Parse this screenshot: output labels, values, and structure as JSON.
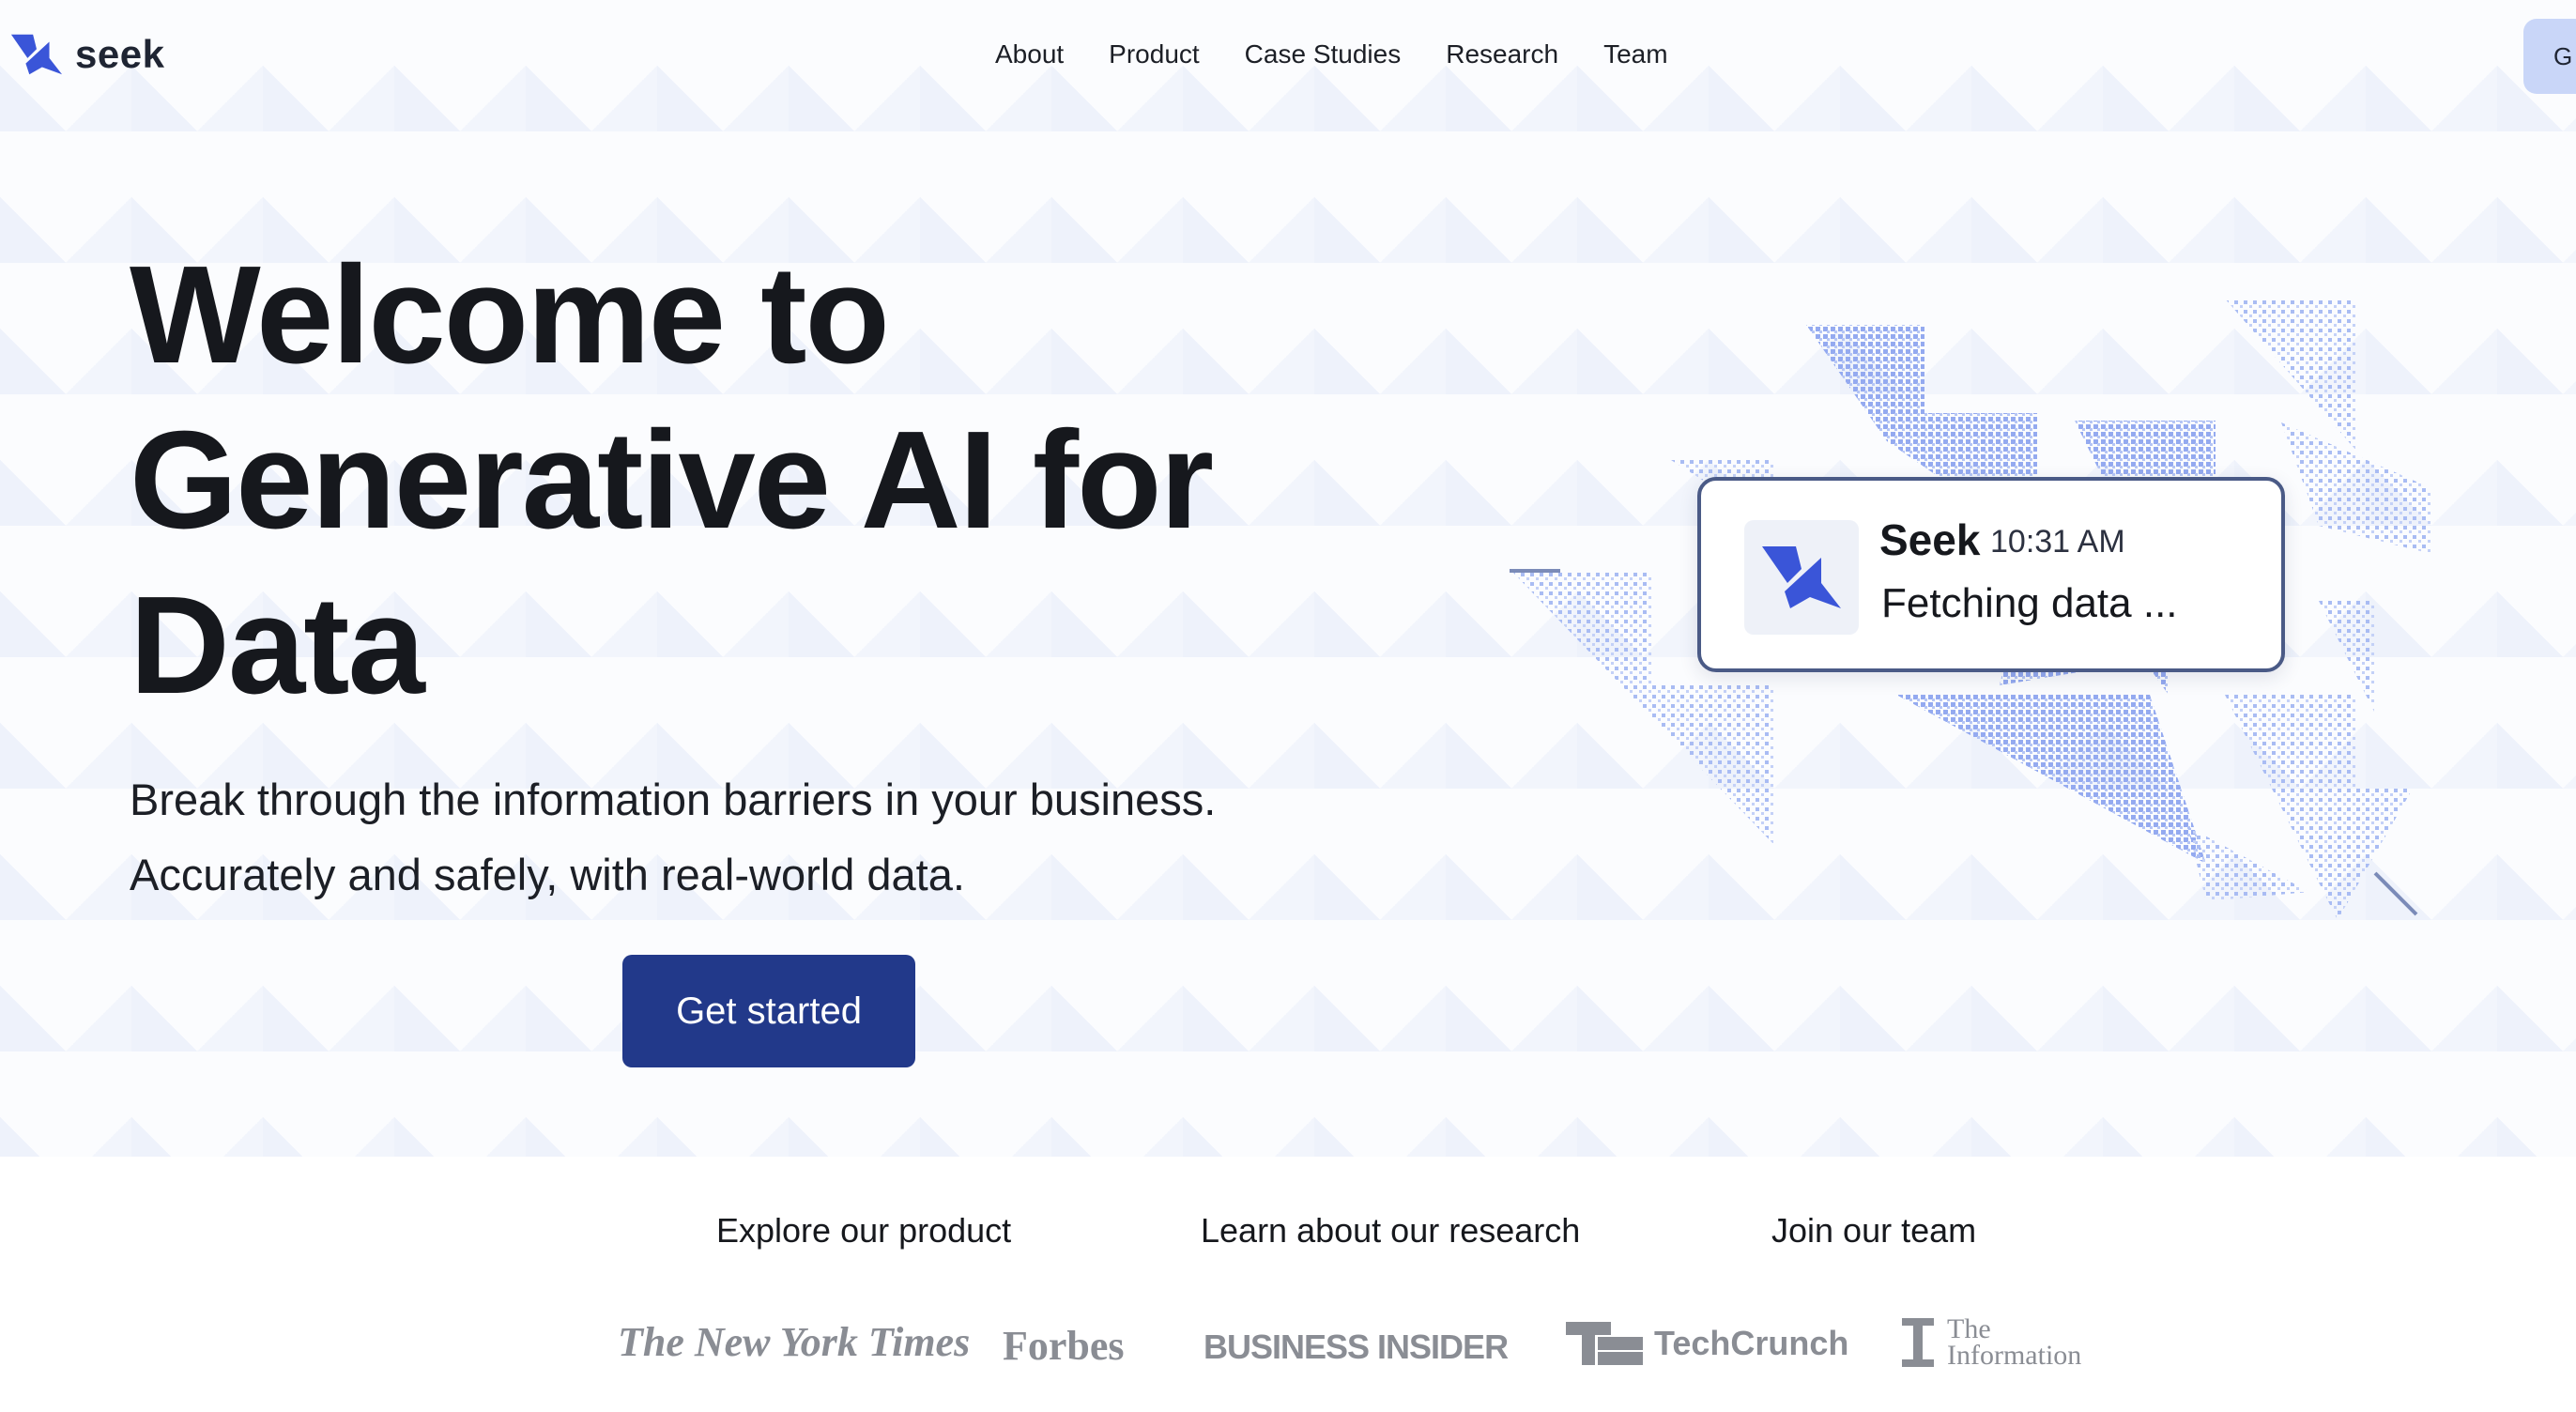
{
  "brand": {
    "name": "seek",
    "accent": "#22398a",
    "logo_blue": "#3a55d8",
    "pixel_blue": "#94aaf0"
  },
  "nav": {
    "items": [
      "About",
      "Product",
      "Case Studies",
      "Research",
      "Team"
    ],
    "top_button_label": "G"
  },
  "hero": {
    "headline": [
      "Welcome to",
      "Generative AI for",
      "Data"
    ],
    "subtitle": [
      "Break through the information barriers in your business.",
      "Accurately and safely, with real-world data."
    ],
    "cta_label": "Get started"
  },
  "chat_card": {
    "name": "Seek",
    "time": "10:31 AM",
    "status": "Fetching data ..."
  },
  "section_links": [
    "Explore our product",
    "Learn about our research",
    "Join our team"
  ],
  "press_logos": {
    "nyt": "The New York Times",
    "forbes": "Forbes",
    "business_insider": "BUSINESS INSIDER",
    "techcrunch": "TechCrunch",
    "the_information": [
      "The",
      "Information"
    ]
  }
}
